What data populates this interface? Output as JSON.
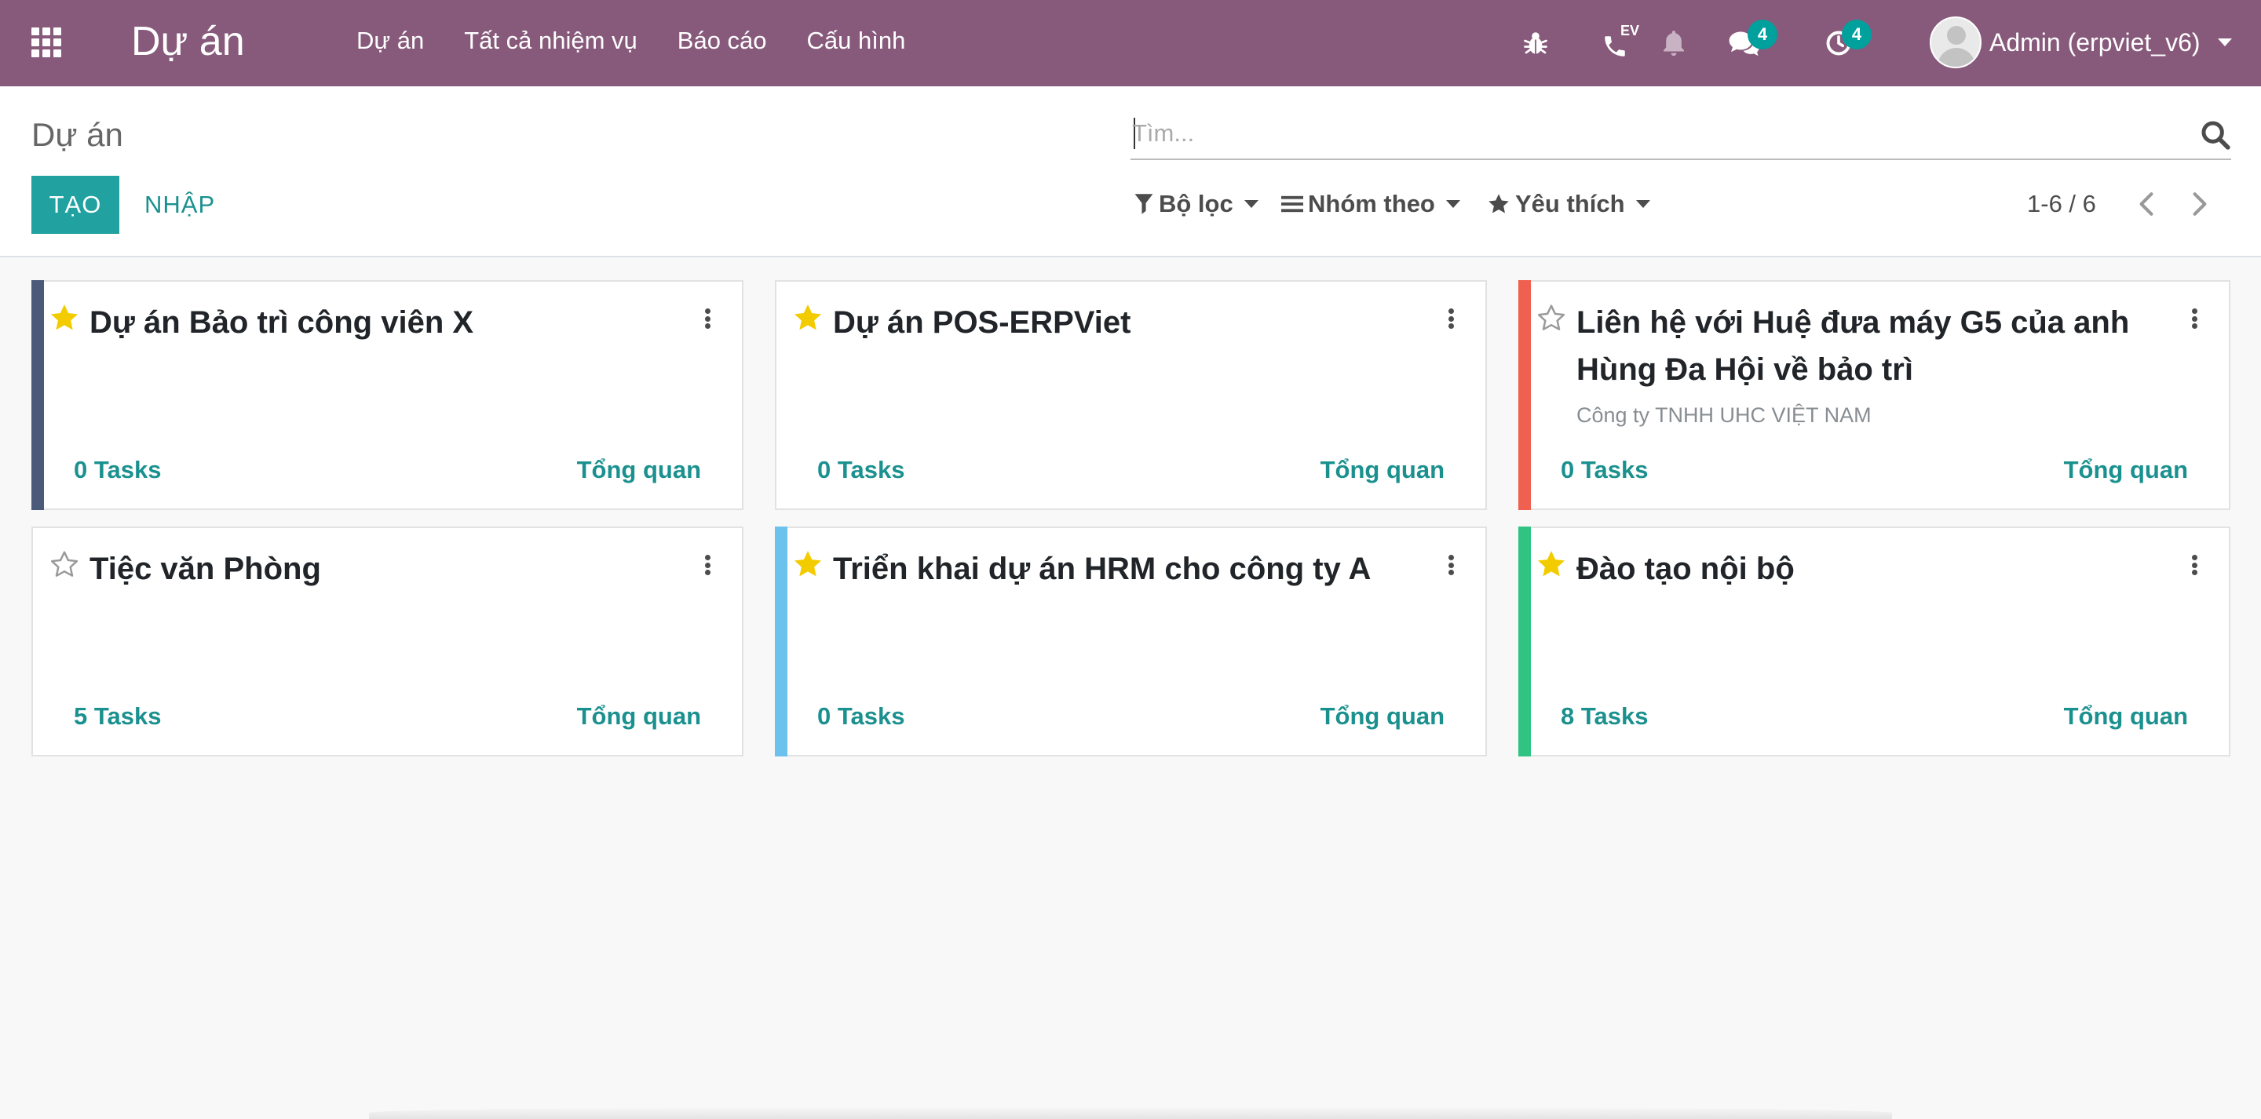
{
  "navbar": {
    "app_title": "Dự án",
    "menu": [
      {
        "label": "Dự án"
      },
      {
        "label": "Tất cả nhiệm vụ"
      },
      {
        "label": "Báo cáo"
      },
      {
        "label": "Cấu hình"
      }
    ],
    "systray": {
      "debug_icon": "bug-icon",
      "phone_label": "EV",
      "messages_count": "4",
      "activities_count": "4"
    },
    "user_name": "Admin (erpviet_v6)",
    "color": "#875a7b"
  },
  "control_panel": {
    "breadcrumb": "Dự án",
    "search_placeholder": "Tìm...",
    "create_label": "TẠO",
    "import_label": "NHẬP",
    "filters_label": "Bộ lọc",
    "group_by_label": "Nhóm theo",
    "favorites_label": "Yêu thích",
    "pager": "1-6 / 6"
  },
  "projects": [
    {
      "name": "Dự án Bảo trì công viên X",
      "partner": "",
      "favorite": true,
      "color": "#4c5a7a",
      "task_count": "0",
      "task_word": "Tasks",
      "overview": "Tổng quan"
    },
    {
      "name": "Dự án POS-ERPViet",
      "partner": "",
      "favorite": true,
      "color": "",
      "task_count": "0",
      "task_word": "Tasks",
      "overview": "Tổng quan"
    },
    {
      "name": "Liên hệ với Huệ đưa máy G5 của anh Hùng Đa Hội về bảo trì",
      "partner": "Công ty TNHH UHC VIỆT NAM",
      "favorite": false,
      "color": "#f06050",
      "task_count": "0",
      "task_word": "Tasks",
      "overview": "Tổng quan"
    },
    {
      "name": "Tiệc văn Phòng",
      "partner": "",
      "favorite": false,
      "color": "",
      "task_count": "5",
      "task_word": "Tasks",
      "overview": "Tổng quan"
    },
    {
      "name": "Triển khai dự án HRM cho công ty A",
      "partner": "",
      "favorite": true,
      "color": "#6cc1ed",
      "task_count": "0",
      "task_word": "Tasks",
      "overview": "Tổng quan"
    },
    {
      "name": "Đào tạo nội bộ",
      "partner": "",
      "favorite": true,
      "color": "#30c381",
      "task_count": "8",
      "task_word": "Tasks",
      "overview": "Tổng quan"
    }
  ],
  "colors": {
    "accent": "#21a1a0",
    "link": "#1b918f",
    "star_on": "#f3cc00",
    "star_off": "#9a9a9a"
  }
}
